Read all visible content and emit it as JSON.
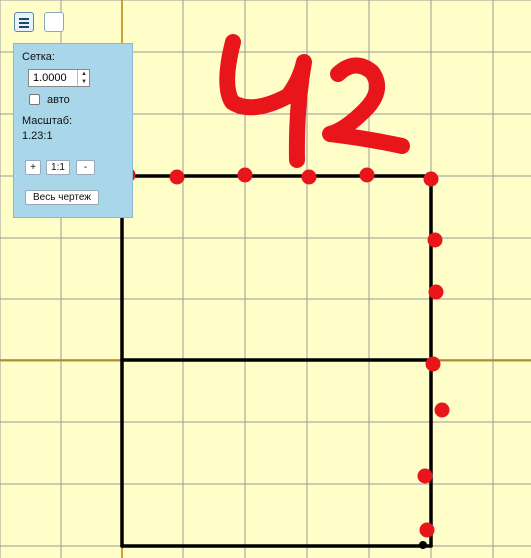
{
  "colors": {
    "background": "#fffdc8",
    "grid": "#9a9a9a",
    "axis": "#b8860b",
    "shape": "#000000",
    "points": "#e8161b",
    "panel": "#a9d6e8"
  },
  "toolbar": {
    "menu_icon": "hamburger-icon",
    "blank_icon": "blank-square"
  },
  "panel": {
    "grid_label": "Сетка:",
    "grid_value": "1.0000",
    "auto_label": "авто",
    "auto_checked": false,
    "scale_label": "Масштаб:",
    "scale_value": "1.23:1",
    "zoom_in_label": "+",
    "zoom_reset_label": "1:1",
    "zoom_out_label": "-",
    "fit_label": "Весь чертеж"
  },
  "drawing": {
    "handwritten_text": "42"
  }
}
